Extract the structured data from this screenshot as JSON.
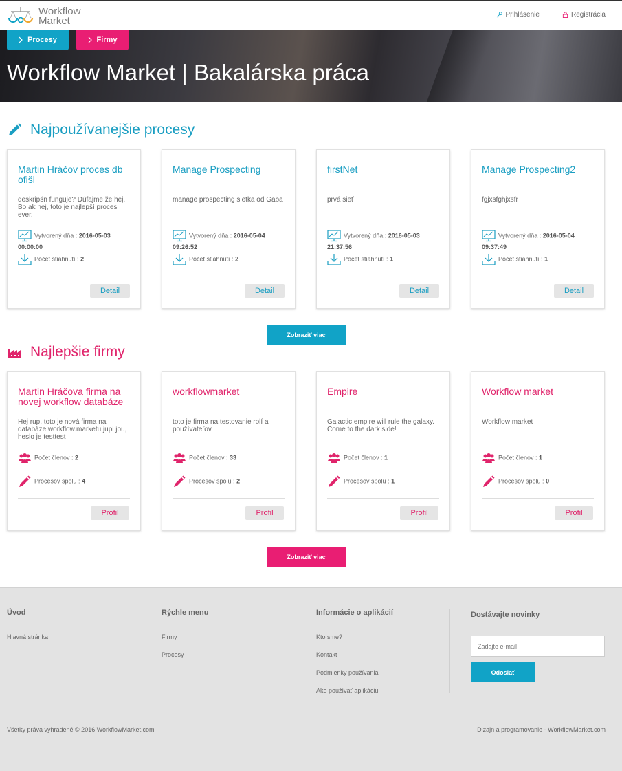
{
  "header": {
    "logo_text_1": "Workflow",
    "logo_text_2": "Market",
    "login": "Prihlásenie",
    "register": "Registrácia"
  },
  "hero": {
    "tab_processes": "Procesy",
    "tab_companies": "Firmy",
    "title": "Workflow Market | Bakalárska práca"
  },
  "processes": {
    "heading": "Najpoužívanejšie procesy",
    "created_label": "Vytvorený dňa :",
    "downloads_label": "Počet stiahnutí :",
    "detail_label": "Detail",
    "more_label": "Zobraziť viac",
    "items": [
      {
        "title": "Martin Hráčov proces db ofišl",
        "desc": "deskripšn funguje? Dúfajme že hej. Bo ak hej, toto je najlepší proces ever.",
        "date": "2016-05-03",
        "time": "00:00:00",
        "downloads": "2"
      },
      {
        "title": "Manage Prospecting",
        "desc": "manage prospecting sietka od Gaba",
        "date": "2016-05-04",
        "time": "09:26:52",
        "downloads": "2"
      },
      {
        "title": "firstNet",
        "desc": "prvá sieť",
        "date": "2016-05-03",
        "time": "21:37:56",
        "downloads": "1"
      },
      {
        "title": "Manage Prospecting2",
        "desc": "fgjxsfghjxsfr",
        "date": "2016-05-04",
        "time": "09:37:49",
        "downloads": "1"
      }
    ]
  },
  "companies": {
    "heading": "Najlepšie firmy",
    "members_label": "Počet členov :",
    "processes_label": "Procesov spolu :",
    "profile_label": "Profil",
    "more_label": "Zobraziť viac",
    "items": [
      {
        "title": "Martin Hráčova firma na novej workflow databáze",
        "desc": "Hej rup, toto je nová firma na databáze workflow.marketu jupi jou, heslo je testtest",
        "members": "2",
        "processes": "4"
      },
      {
        "title": "workflowmarket",
        "desc": "toto je firma na testovanie rolí a používateľov",
        "members": "33",
        "processes": "2"
      },
      {
        "title": "Empire",
        "desc": "Galactic empire will rule the galaxy. Come to the dark side!",
        "members": "1",
        "processes": "1"
      },
      {
        "title": "Workflow market",
        "desc": "Workflow market",
        "members": "1",
        "processes": "0"
      }
    ]
  },
  "footer": {
    "col1": {
      "heading": "Úvod",
      "items": [
        "Hlavná stránka"
      ]
    },
    "col2": {
      "heading": "Rýchle menu",
      "items": [
        "Firmy",
        "Procesy"
      ]
    },
    "col3": {
      "heading": "Informácie o aplikácií",
      "items": [
        "Kto sme?",
        "Kontakt",
        "Podmienky používania",
        "Ako používať aplikáciu"
      ]
    },
    "newsletter": {
      "heading": "Dostávajte novinky",
      "placeholder": "Zadajte e-mail",
      "button": "Odoslať"
    },
    "copyright": "Všetky práva vyhradené © 2016 WorkflowMarket.com",
    "credit": "Dizajn a programovanie - WorkflowMarket.com"
  },
  "colors": {
    "blue": "#11a3c7",
    "pink": "#e91e73"
  }
}
